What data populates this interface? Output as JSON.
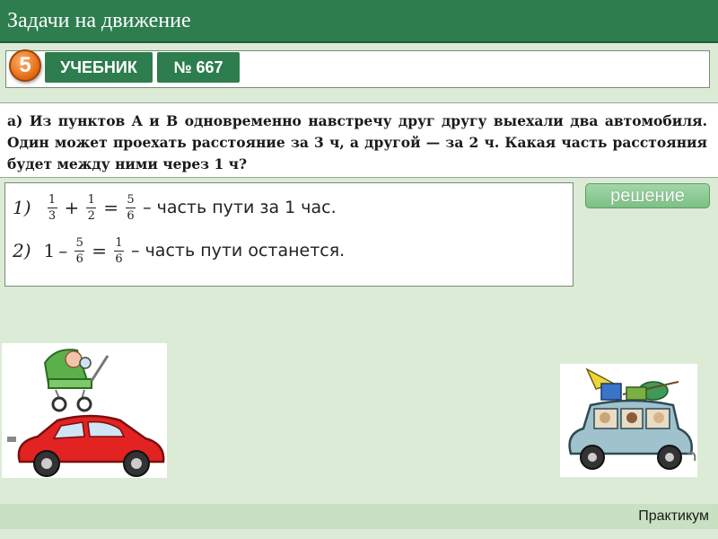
{
  "header": {
    "title": "Задачи на движение"
  },
  "toolbar": {
    "grade": "5",
    "textbook_label": "УЧЕБНИК",
    "exercise_number": "№ 667"
  },
  "problem": {
    "text": "а) Из пунктов A и B одновременно навстречу друг другу выехали два автомобиля. Один может проехать расстояние за 3 ч, а другой — за 2 ч. Какая часть расстояния будет между ними через 1 ч?"
  },
  "solution": {
    "step1": {
      "index": "1)",
      "f1_num": "1",
      "f1_den": "3",
      "op1": "+",
      "f2_num": "1",
      "f2_den": "2",
      "op2": "=",
      "f3_num": "5",
      "f3_den": "6",
      "text": "– часть пути за 1 час."
    },
    "step2": {
      "index": "2)",
      "whole": "1",
      "op1": "–",
      "f1_num": "5",
      "f1_den": "6",
      "op2": "=",
      "f2_num": "1",
      "f2_den": "6",
      "text": "– часть пути останется."
    }
  },
  "solution_button": {
    "label": "решение"
  },
  "footer": {
    "label": "Практикум"
  },
  "colors": {
    "accent": "#2e7d4f",
    "background": "#dcebd6",
    "grade_circle": "#e8701a",
    "button": "#8fcb95"
  }
}
